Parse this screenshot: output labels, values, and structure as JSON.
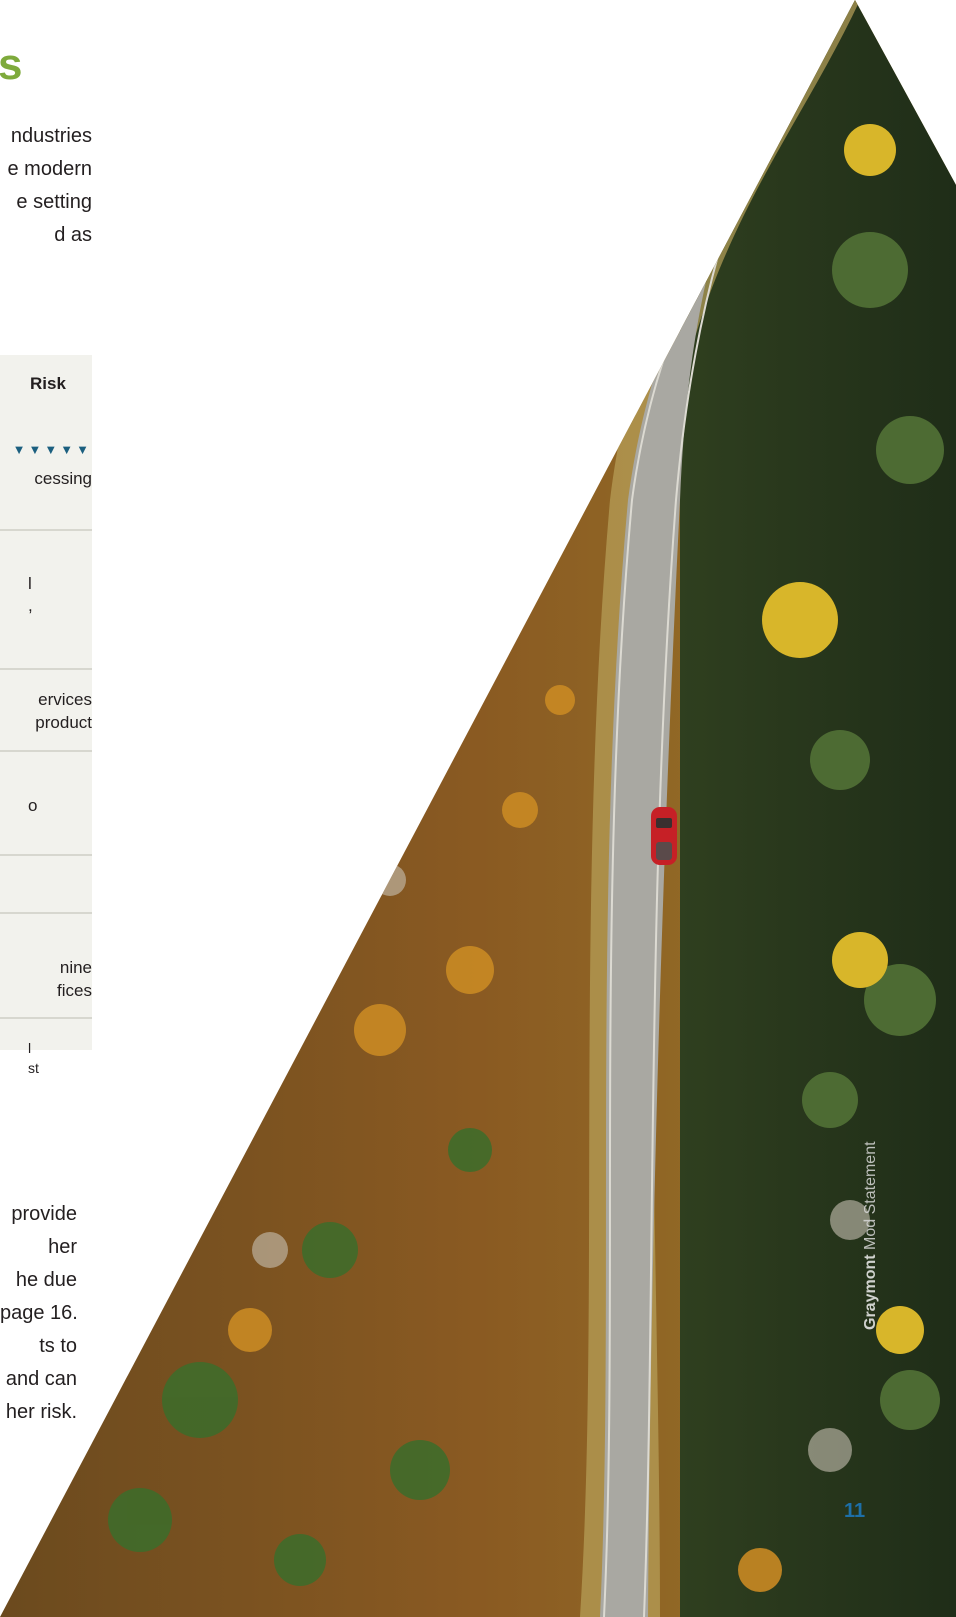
{
  "heading": "s",
  "intro_lines": [
    "ndustries",
    "e modern",
    "e setting",
    "d as"
  ],
  "table": {
    "risk_header": "Risk",
    "triangles": "▼▼▼▼▼",
    "row_1": [
      "cessing"
    ],
    "row_2": [
      "l",
      ","
    ],
    "row_3": [
      "ervices",
      "product"
    ],
    "row_4": [
      "o"
    ],
    "row_6": [
      "nine",
      "fices"
    ],
    "footnote": [
      "l",
      "st"
    ]
  },
  "body_lines": [
    "provide",
    "her",
    "he due",
    "page 16.",
    "ts to",
    "and can",
    "her risk."
  ],
  "footer": {
    "company": "Graymont",
    "title_visible": "Mod",
    "title_tail": "Statement"
  },
  "page_number": "11",
  "colors": {
    "heading_green": "#7eaa3c",
    "accent_blue": "#1b5f7f",
    "table_bg": "#f2f2ed",
    "page_number_blue": "#1d6fa8"
  }
}
